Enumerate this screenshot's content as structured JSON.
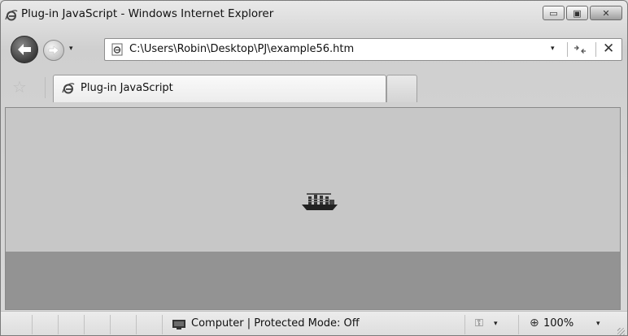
{
  "window": {
    "title": "Plug-in JavaScript - Windows Internet Explorer",
    "minimize_glyph": "▭",
    "maximize_glyph": "▣",
    "close_glyph": "✕"
  },
  "nav": {
    "address": "C:\\Users\\Robin\\Desktop\\PJ\\example56.htm",
    "dropdown_glyph": "▾",
    "refresh_glyph": "⁴↯",
    "stop_glyph": "✕"
  },
  "tabs": [
    {
      "label": "Plug-in JavaScript",
      "icon": "ie-icon"
    }
  ],
  "status": {
    "zone_text": "Computer | Protected Mode: Off",
    "zoom": "100%",
    "zoom_glyph": "⊕",
    "security_glyph": "⚿",
    "dropdown_glyph": "▾"
  },
  "colors": {
    "sky": "#c7c7c7",
    "sea": "#939393"
  }
}
